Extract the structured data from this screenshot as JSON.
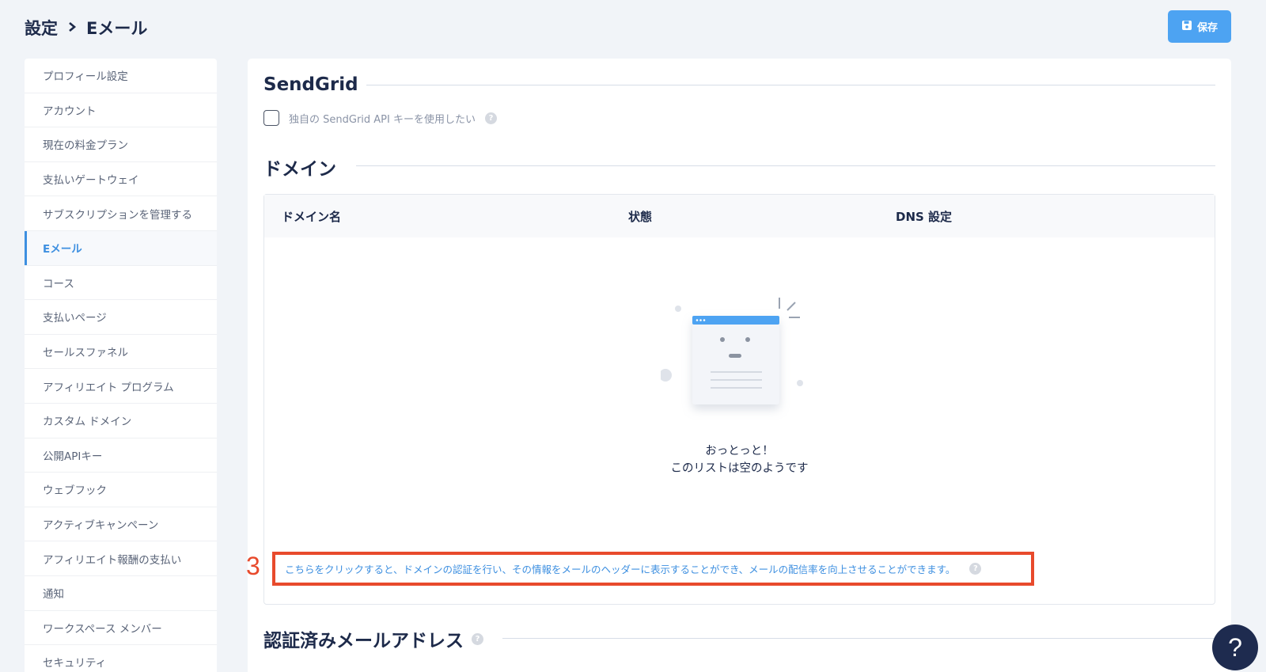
{
  "header": {
    "breadcrumb_parent": "設定",
    "breadcrumb_current": "Eメール",
    "save_label": "保存"
  },
  "sidebar": {
    "items": [
      {
        "label": "プロフィール設定"
      },
      {
        "label": "アカウント"
      },
      {
        "label": "現在の料金プラン"
      },
      {
        "label": "支払いゲートウェイ"
      },
      {
        "label": "サブスクリプションを管理する"
      },
      {
        "label": "Eメール",
        "active": true
      },
      {
        "label": "コース"
      },
      {
        "label": "支払いページ"
      },
      {
        "label": "セールスファネル"
      },
      {
        "label": "アフィリエイト プログラム"
      },
      {
        "label": "カスタム ドメイン"
      },
      {
        "label": "公開APIキー"
      },
      {
        "label": "ウェブフック"
      },
      {
        "label": "アクティブキャンペーン"
      },
      {
        "label": "アフィリエイト報酬の支払い"
      },
      {
        "label": "通知"
      },
      {
        "label": "ワークスペース メンバー"
      },
      {
        "label": "セキュリティ"
      }
    ]
  },
  "sendgrid": {
    "title": "SendGrid",
    "checkbox_label": "独自の SendGrid API キーを使用したい",
    "checked": false
  },
  "domain": {
    "title": "ドメイン",
    "columns": [
      "ドメイン名",
      "状態",
      "DNS 設定"
    ],
    "empty_title": "おっとっと！",
    "empty_subtitle": "このリストは空のようです",
    "hint_link": "こちらをクリックすると、ドメインの認証を行い、その情報をメールのヘッダーに表示することができ、メールの配信率を向上させることができます。"
  },
  "verified": {
    "title": "認証済みメールアドレス"
  },
  "annotation": {
    "marker": "3"
  },
  "help_button": "?",
  "help_icon": "?",
  "colors": {
    "accent": "#4da3f2",
    "annotation": "#e84a2c",
    "navy": "#1e2b4f"
  }
}
